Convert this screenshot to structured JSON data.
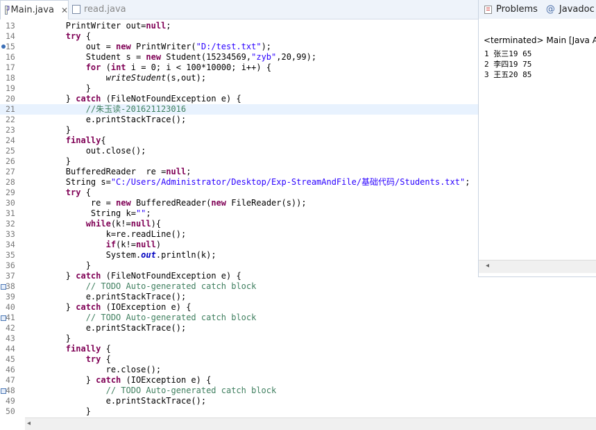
{
  "tabs": [
    {
      "label": "Main.java",
      "active": true,
      "close": "✕"
    },
    {
      "label": "read.java",
      "active": false
    }
  ],
  "console": {
    "tabs": [
      {
        "label": "Problems",
        "icon": "problems-icon"
      },
      {
        "label": "Javadoc",
        "icon": "javadoc-icon"
      }
    ],
    "terminated": "<terminated> Main [Java Ap",
    "output": [
      "1 张三19 65",
      "2 李四19 75",
      "3 王五20 85"
    ]
  },
  "editor": {
    "current_line": 21,
    "lines": [
      {
        "n": "13",
        "html": "        PrintWriter out=<span class=\"kw\">null</span>;"
      },
      {
        "n": "14",
        "html": "        <span class=\"kw\">try</span> {"
      },
      {
        "n": "15",
        "html": "            out = <span class=\"kw\">new</span> PrintWriter(<span class=\"str\">\"D:/test.txt\"</span>);",
        "marker": "bp"
      },
      {
        "n": "16",
        "html": "            Student s = <span class=\"kw\">new</span> Student(15234569,<span class=\"str\">\"zyb\"</span>,20,99);"
      },
      {
        "n": "17",
        "html": "            <span class=\"kw\">for</span> (<span class=\"kw\">int</span> i = 0; i &lt; 100*10000; i++) {"
      },
      {
        "n": "18",
        "html": "                <span class=\"it\">writeStudent</span>(s,out);"
      },
      {
        "n": "19",
        "html": "            }"
      },
      {
        "n": "20",
        "html": "        } <span class=\"kw\">catch</span> (FileNotFoundException e) {"
      },
      {
        "n": "21",
        "html": "            <span class=\"cm\">//朱玉读-201621123016</span>"
      },
      {
        "n": "22",
        "html": "            e.printStackTrace();"
      },
      {
        "n": "23",
        "html": "        }"
      },
      {
        "n": "24",
        "html": "        <span class=\"kw\">finally</span>{"
      },
      {
        "n": "25",
        "html": "            out.close();"
      },
      {
        "n": "26",
        "html": "        }"
      },
      {
        "n": "27",
        "html": "        BufferedReader  re =<span class=\"kw\">null</span>;"
      },
      {
        "n": "28",
        "html": "        String s=<span class=\"str\">\"C:/Users/Administrator/Desktop/Exp-StreamAndFile/基础代码/Students.txt\"</span>;"
      },
      {
        "n": "29",
        "html": "        <span class=\"kw\">try</span> {"
      },
      {
        "n": "30",
        "html": "             re = <span class=\"kw\">new</span> BufferedReader(<span class=\"kw\">new</span> FileReader(s));"
      },
      {
        "n": "31",
        "html": "             String k=<span class=\"str\">\"\"</span>;"
      },
      {
        "n": "32",
        "html": "            <span class=\"kw\">while</span>(k!=<span class=\"kw\">null</span>){"
      },
      {
        "n": "33",
        "html": "                k=re.readLine();"
      },
      {
        "n": "34",
        "html": "                <span class=\"kw\">if</span>(k!=<span class=\"kw\">null</span>)"
      },
      {
        "n": "35",
        "html": "                System.<span class=\"fld\">out</span>.println(k);"
      },
      {
        "n": "36",
        "html": "            }"
      },
      {
        "n": "37",
        "html": "        } <span class=\"kw\">catch</span> (FileNotFoundException e) {"
      },
      {
        "n": "38",
        "html": "            <span class=\"cm\">// TODO Auto-generated catch block</span>",
        "marker": "todo"
      },
      {
        "n": "39",
        "html": "            e.printStackTrace();"
      },
      {
        "n": "40",
        "html": "        } <span class=\"kw\">catch</span> (IOException e) {"
      },
      {
        "n": "41",
        "html": "            <span class=\"cm\">// TODO Auto-generated catch block</span>",
        "marker": "todo"
      },
      {
        "n": "42",
        "html": "            e.printStackTrace();"
      },
      {
        "n": "43",
        "html": "        }"
      },
      {
        "n": "44",
        "html": "        <span class=\"kw\">finally</span> {"
      },
      {
        "n": "45",
        "html": "            <span class=\"kw\">try</span> {"
      },
      {
        "n": "46",
        "html": "                re.close();"
      },
      {
        "n": "47",
        "html": "            } <span class=\"kw\">catch</span> (IOException e) {"
      },
      {
        "n": "48",
        "html": "                <span class=\"cm\">// TODO Auto-generated catch block</span>",
        "marker": "todo"
      },
      {
        "n": "49",
        "html": "                e.printStackTrace();"
      },
      {
        "n": "50",
        "html": "            }"
      }
    ]
  },
  "colors": {
    "keyword": "#7f0055",
    "string": "#2a00ff",
    "comment": "#3f7f5f",
    "current_line_bg": "#e8f2fe"
  }
}
